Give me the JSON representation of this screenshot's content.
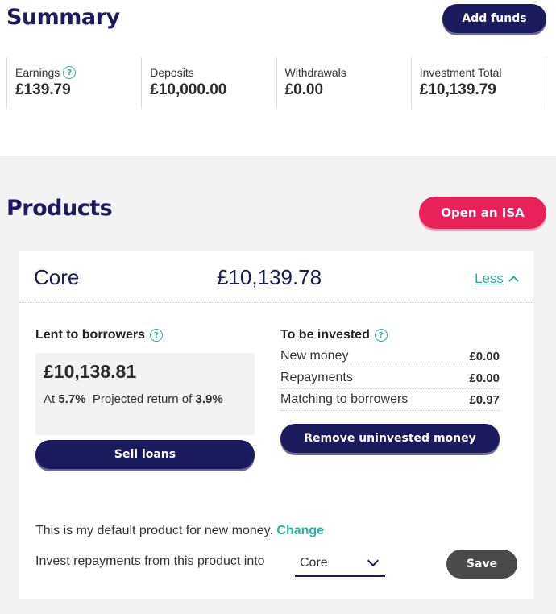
{
  "summary": {
    "title": "Summary",
    "add_funds_label": "Add funds",
    "stats": [
      {
        "label": "Earnings",
        "value": "£139.79"
      },
      {
        "label": "Deposits",
        "value": "£10,000.00"
      },
      {
        "label": "Withdrawals",
        "value": "£0.00"
      },
      {
        "label": "Investment Total",
        "value": "£10,139.79"
      }
    ]
  },
  "products": {
    "title": "Products",
    "open_isa_label": "Open an ISA",
    "card": {
      "name": "Core",
      "total": "£10,139.78",
      "toggle_label": "Less",
      "lent": {
        "title": "Lent to borrowers",
        "amount": "£10,138.81",
        "at_prefix": "At",
        "rate": "5.7%",
        "projected_label": "Projected return of",
        "projected_value": "3.9%",
        "sell_label": "Sell loans"
      },
      "to_invest": {
        "title": "To be invested",
        "rows": [
          {
            "label": "New money",
            "value": "£0.00"
          },
          {
            "label": "Repayments",
            "value": "£0.00"
          },
          {
            "label": "Matching to borrowers",
            "value": "£0.97"
          }
        ],
        "remove_label": "Remove uninvested money"
      },
      "default_text": "This is my default product for new money.",
      "change_label": "Change",
      "invest_into_label": "Invest repayments from this product into",
      "invest_into_value": "Core",
      "save_label": "Save"
    }
  },
  "colors": {
    "navy": "#1b1a5c",
    "pink": "#e8215a",
    "teal": "#2ab0a3",
    "grey_button": "#4a4a4a"
  },
  "icons": [
    "help-icon",
    "chevron-up-icon",
    "chevron-down-icon"
  ]
}
